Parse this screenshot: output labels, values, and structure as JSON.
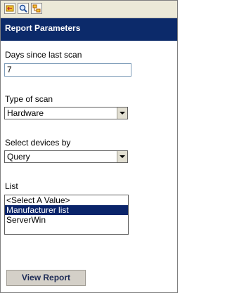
{
  "toolbar": {
    "buttons": [
      {
        "icon": "back-arrow-icon"
      },
      {
        "icon": "search-icon"
      },
      {
        "icon": "tree-view-icon"
      }
    ]
  },
  "panel": {
    "title": "Report Parameters"
  },
  "params": {
    "days_label": "Days since last scan",
    "days_value": "7",
    "scan_type_label": "Type of scan",
    "scan_type_value": "Hardware",
    "select_by_label": "Select devices by",
    "select_by_value": "Query",
    "list_label": "List",
    "list_items": [
      "<Select A Value>",
      "Manufacturer list",
      "ServerWin"
    ],
    "list_selected": "Manufacturer list"
  },
  "actions": {
    "view_report_label": "View Report"
  },
  "colors": {
    "header_bg": "#0c2a6a",
    "selection_bg": "#0a246a"
  }
}
